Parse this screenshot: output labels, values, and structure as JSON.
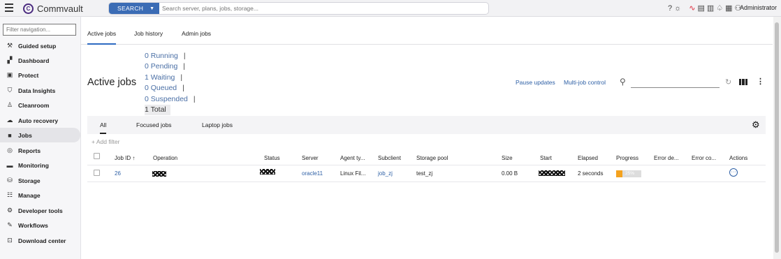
{
  "header": {
    "app_name": "Commvault",
    "search_button_label": "SEARCH",
    "search_placeholder": "Search server, plans, jobs, storage...",
    "user": "Administrator",
    "icons": [
      "help-icon",
      "theme-icon",
      "alert-pulse-icon",
      "reports-icon",
      "documents-icon",
      "notifications-icon",
      "calendar-icon",
      "user-icon"
    ]
  },
  "sidebar": {
    "filter_placeholder": "Filter navigation...",
    "items": [
      {
        "label": "Guided setup",
        "icon": "guided-setup-icon"
      },
      {
        "label": "Dashboard",
        "icon": "dashboard-icon"
      },
      {
        "label": "Protect",
        "icon": "protect-icon"
      },
      {
        "label": "Data Insights",
        "icon": "shield-icon"
      },
      {
        "label": "Cleanroom",
        "icon": "cleanroom-icon"
      },
      {
        "label": "Auto recovery",
        "icon": "auto-recovery-icon"
      },
      {
        "label": "Jobs",
        "icon": "briefcase-icon"
      },
      {
        "label": "Reports",
        "icon": "reports-icon"
      },
      {
        "label": "Monitoring",
        "icon": "monitoring-icon"
      },
      {
        "label": "Storage",
        "icon": "database-icon"
      },
      {
        "label": "Manage",
        "icon": "manage-icon"
      },
      {
        "label": "Developer tools",
        "icon": "developer-tools-icon"
      },
      {
        "label": "Workflows",
        "icon": "workflows-icon"
      },
      {
        "label": "Download center",
        "icon": "download-icon"
      }
    ],
    "active": "Jobs"
  },
  "tabs": [
    "Active jobs",
    "Job history",
    "Admin jobs"
  ],
  "page_title": "Active jobs",
  "summary": {
    "running": "0 Running",
    "pending": "0 Pending",
    "waiting": "1 Waiting",
    "queued": "0 Queued",
    "suspended": "0 Suspended",
    "total": "1 Total",
    "separator": "|"
  },
  "toolbar": {
    "pause_updates": "Pause updates",
    "multi_job_control": "Multi-job control"
  },
  "views": [
    "All",
    "Focused jobs",
    "Laptop jobs"
  ],
  "add_filter": "+ Add filter",
  "table": {
    "columns": [
      "Job ID",
      "Operation",
      "Status",
      "Server",
      "Agent ty...",
      "Subclient",
      "Storage pool",
      "Size",
      "Start",
      "Elapsed",
      "Progress",
      "Error de...",
      "Error co...",
      "Actions"
    ],
    "sort_indicator": "↑",
    "rows": [
      {
        "job_id": "26",
        "server": "oracle11",
        "agent_type": "Linux Fil...",
        "subclient": "job_zj",
        "storage_pool": "test_zj",
        "size": "0.00 B",
        "elapsed": "2 seconds",
        "progress_label": "25%",
        "progress_fraction": 0.25
      }
    ]
  },
  "colors": {
    "accent": "#3b6cb5",
    "link": "#2d5fa5",
    "progress": "#f4a21e"
  }
}
